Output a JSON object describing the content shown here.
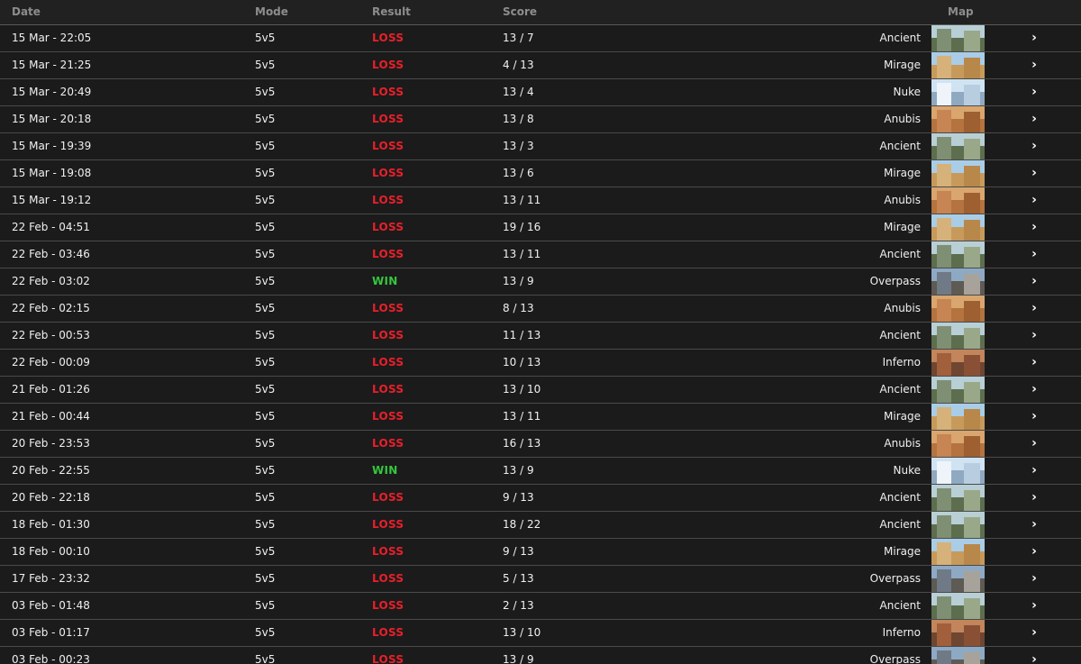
{
  "header": {
    "date": "Date",
    "mode": "Mode",
    "result": "Result",
    "score": "Score",
    "map": "Map"
  },
  "colors": {
    "loss": "#e8202a",
    "win": "#35c73d",
    "background": "#1b1b1b"
  },
  "map_thumbs": {
    "Ancient": {
      "sky": "#b9cfd6",
      "ground": "#5d6e4e",
      "wall": "#7f8f73",
      "wall2": "#9aa88a"
    },
    "Mirage": {
      "sky": "#a9cde6",
      "ground": "#c79a5b",
      "wall": "#d6b27a",
      "wall2": "#b8874a"
    },
    "Nuke": {
      "sky": "#cfe3f3",
      "ground": "#8fa9c0",
      "wall": "#eef4fa",
      "wall2": "#b8cde0"
    },
    "Anubis": {
      "sky": "#d9a66f",
      "ground": "#b4733f",
      "wall": "#c68552",
      "wall2": "#9e5f31"
    },
    "Overpass": {
      "sky": "#8ea9c4",
      "ground": "#5e5a54",
      "wall": "#6f7a86",
      "wall2": "#a7a39a"
    },
    "Inferno": {
      "sky": "#c2855c",
      "ground": "#6f4630",
      "wall": "#a15f3c",
      "wall2": "#8a5036"
    }
  },
  "matches": [
    {
      "date": "15 Mar - 22:05",
      "mode": "5v5",
      "result": "LOSS",
      "score": "13 / 7",
      "map": "Ancient"
    },
    {
      "date": "15 Mar - 21:25",
      "mode": "5v5",
      "result": "LOSS",
      "score": "4 / 13",
      "map": "Mirage"
    },
    {
      "date": "15 Mar - 20:49",
      "mode": "5v5",
      "result": "LOSS",
      "score": "13 / 4",
      "map": "Nuke"
    },
    {
      "date": "15 Mar - 20:18",
      "mode": "5v5",
      "result": "LOSS",
      "score": "13 / 8",
      "map": "Anubis"
    },
    {
      "date": "15 Mar - 19:39",
      "mode": "5v5",
      "result": "LOSS",
      "score": "13 / 3",
      "map": "Ancient"
    },
    {
      "date": "15 Mar - 19:08",
      "mode": "5v5",
      "result": "LOSS",
      "score": "13 / 6",
      "map": "Mirage"
    },
    {
      "date": "15 Mar - 19:12",
      "mode": "5v5",
      "result": "LOSS",
      "score": "13 / 11",
      "map": "Anubis"
    },
    {
      "date": "22 Feb - 04:51",
      "mode": "5v5",
      "result": "LOSS",
      "score": "19 / 16",
      "map": "Mirage"
    },
    {
      "date": "22 Feb - 03:46",
      "mode": "5v5",
      "result": "LOSS",
      "score": "13 / 11",
      "map": "Ancient"
    },
    {
      "date": "22 Feb - 03:02",
      "mode": "5v5",
      "result": "WIN",
      "score": "13 / 9",
      "map": "Overpass"
    },
    {
      "date": "22 Feb - 02:15",
      "mode": "5v5",
      "result": "LOSS",
      "score": "8 / 13",
      "map": "Anubis"
    },
    {
      "date": "22 Feb - 00:53",
      "mode": "5v5",
      "result": "LOSS",
      "score": "11 / 13",
      "map": "Ancient"
    },
    {
      "date": "22 Feb - 00:09",
      "mode": "5v5",
      "result": "LOSS",
      "score": "10 / 13",
      "map": "Inferno"
    },
    {
      "date": "21 Feb - 01:26",
      "mode": "5v5",
      "result": "LOSS",
      "score": "13 / 10",
      "map": "Ancient"
    },
    {
      "date": "21 Feb - 00:44",
      "mode": "5v5",
      "result": "LOSS",
      "score": "13 / 11",
      "map": "Mirage"
    },
    {
      "date": "20 Feb - 23:53",
      "mode": "5v5",
      "result": "LOSS",
      "score": "16 / 13",
      "map": "Anubis"
    },
    {
      "date": "20 Feb - 22:55",
      "mode": "5v5",
      "result": "WIN",
      "score": "13 / 9",
      "map": "Nuke"
    },
    {
      "date": "20 Feb - 22:18",
      "mode": "5v5",
      "result": "LOSS",
      "score": "9 / 13",
      "map": "Ancient"
    },
    {
      "date": "18 Feb - 01:30",
      "mode": "5v5",
      "result": "LOSS",
      "score": "18 / 22",
      "map": "Ancient"
    },
    {
      "date": "18 Feb - 00:10",
      "mode": "5v5",
      "result": "LOSS",
      "score": "9 / 13",
      "map": "Mirage"
    },
    {
      "date": "17 Feb - 23:32",
      "mode": "5v5",
      "result": "LOSS",
      "score": "5 / 13",
      "map": "Overpass"
    },
    {
      "date": "03 Feb - 01:48",
      "mode": "5v5",
      "result": "LOSS",
      "score": "2 / 13",
      "map": "Ancient"
    },
    {
      "date": "03 Feb - 01:17",
      "mode": "5v5",
      "result": "LOSS",
      "score": "13 / 10",
      "map": "Inferno"
    },
    {
      "date": "03 Feb - 00:23",
      "mode": "5v5",
      "result": "LOSS",
      "score": "13 / 9",
      "map": "Overpass"
    }
  ],
  "row_action_icon": "chevron-right-icon",
  "row_action_glyph": "›"
}
